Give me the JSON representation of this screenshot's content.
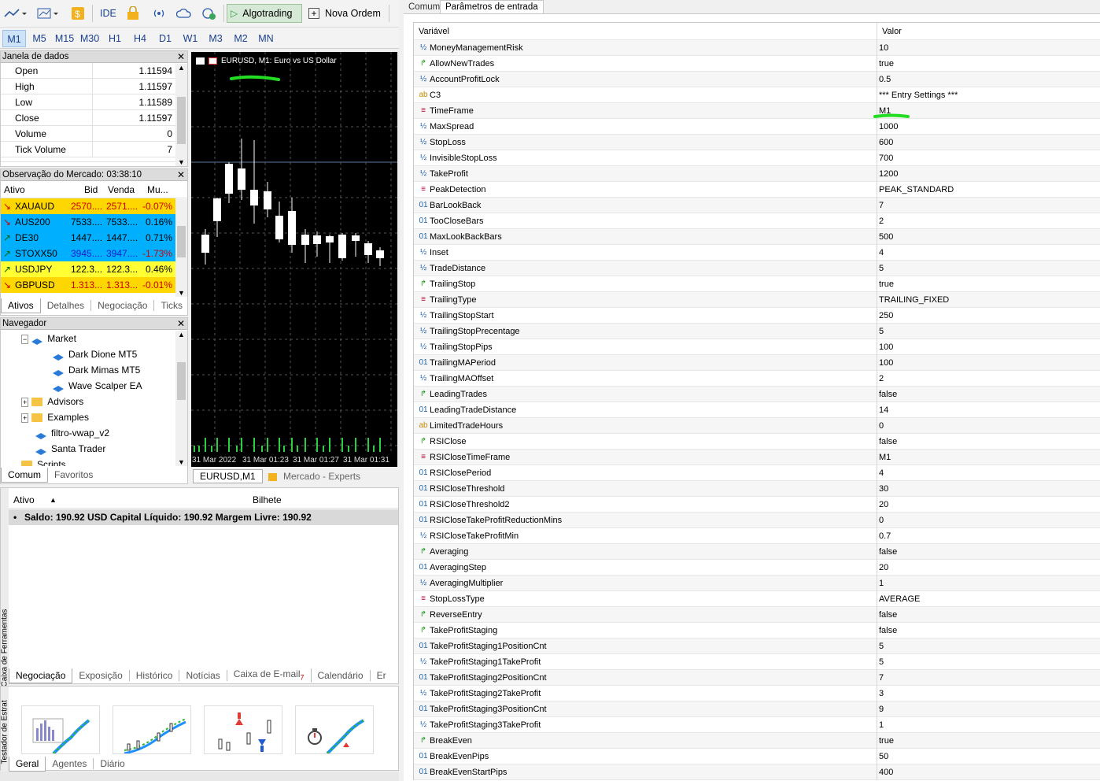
{
  "toolbar": {
    "ide": "IDE",
    "algotrading": "Algotrading",
    "nova_ordem": "Nova Ordem"
  },
  "timeframes": [
    "M1",
    "M5",
    "M15",
    "M30",
    "H1",
    "H4",
    "D1",
    "W1",
    "M3",
    "M2",
    "MN"
  ],
  "data_window": {
    "title": "Janela de dados",
    "rows": [
      {
        "k": "Open",
        "v": "1.11594"
      },
      {
        "k": "High",
        "v": "1.11597"
      },
      {
        "k": "Low",
        "v": "1.11589"
      },
      {
        "k": "Close",
        "v": "1.11597"
      },
      {
        "k": "Volume",
        "v": "0"
      },
      {
        "k": "Tick Volume",
        "v": "7"
      }
    ]
  },
  "market_watch": {
    "title": "Observação do Mercado: 03:38:10",
    "headers": [
      "Ativo",
      "Bid",
      "Venda",
      "Mu..."
    ],
    "rows": [
      {
        "sym": "XAUAUD",
        "bid": "2570....",
        "ask": "2571....",
        "chg": "-0.07%",
        "bg": "#ffd700",
        "arrow": "↘",
        "arrowc": "#cc0000",
        "chgc": "#cc0000",
        "bidc": "#cc0000"
      },
      {
        "sym": "AUS200",
        "bid": "7533....",
        "ask": "7533....",
        "chg": "0.16%",
        "bg": "#00b0ff",
        "arrow": "↘",
        "arrowc": "#cc0000",
        "chgc": "#000",
        "bidc": "#000"
      },
      {
        "sym": "DE30",
        "bid": "1447....",
        "ask": "1447....",
        "chg": "0.71%",
        "bg": "#00b0ff",
        "arrow": "↗",
        "arrowc": "#006600",
        "chgc": "#000",
        "bidc": "#000"
      },
      {
        "sym": "STOXX50",
        "bid": "3945....",
        "ask": "3947....",
        "chg": "-1.73%",
        "bg": "#00b0ff",
        "arrow": "↗",
        "arrowc": "#006600",
        "chgc": "#cc0000",
        "bidc": "#1a1ad0"
      },
      {
        "sym": "USDJPY",
        "bid": "122.3...",
        "ask": "122.3...",
        "chg": "0.46%",
        "bg": "#ffff33",
        "arrow": "↗",
        "arrowc": "#006600",
        "chgc": "#000",
        "bidc": "#000"
      },
      {
        "sym": "GBPUSD",
        "bid": "1.313...",
        "ask": "1.313...",
        "chg": "-0.01%",
        "bg": "#ffd700",
        "arrow": "↘",
        "arrowc": "#cc0000",
        "chgc": "#cc0000",
        "bidc": "#cc0000"
      }
    ],
    "tabs": [
      "Ativos",
      "Detalhes",
      "Negociação",
      "Ticks"
    ]
  },
  "navigator": {
    "title": "Navegador",
    "items": [
      "Market",
      "Dark Dione MT5",
      "Dark Mimas MT5",
      "Wave Scalper EA",
      "Advisors",
      "Examples",
      "filtro-vwap_v2",
      "Santa Trader",
      "Scripts"
    ],
    "tabs": [
      "Comum",
      "Favoritos"
    ]
  },
  "chart": {
    "title": "EURUSD, M1:  Euro vs US Dollar",
    "dates": [
      "31 Mar 2022",
      "31 Mar 01:23",
      "31 Mar 01:27",
      "31 Mar 01:31"
    ],
    "tabs": [
      "EURUSD,M1",
      "Mercado - Experts"
    ]
  },
  "toolbox": {
    "headers": [
      "Ativo",
      "Bilhete"
    ],
    "balance": "Saldo: 190.92 USD  Capital Líquido: 190.92  Margem Livre: 190.92",
    "side_label": "Caixa de Ferramentas",
    "tabs": [
      "Negociação",
      "Exposição",
      "Histórico",
      "Notícias",
      "Caixa de E-mail",
      "Calendário",
      "Er"
    ],
    "mail_badge": "7"
  },
  "tester": {
    "side_label": "Testador de Estrat",
    "tabs": [
      "Geral",
      "Agentes",
      "Diário"
    ]
  },
  "params": {
    "tabs": [
      "Comum",
      "Parâmetros de entrada"
    ],
    "headers": [
      "Variável",
      "Valor"
    ],
    "rows": [
      {
        "ic": "½",
        "n": "MoneyManagementRisk",
        "v": "10"
      },
      {
        "ic": "↱",
        "n": "AllowNewTrades",
        "v": "true"
      },
      {
        "ic": "½",
        "n": "AccountProfitLock",
        "v": "0.5"
      },
      {
        "ic": "ab",
        "n": "C3",
        "v": "*** Entry Settings ***"
      },
      {
        "ic": "≡",
        "n": "TimeFrame",
        "v": "M1"
      },
      {
        "ic": "½",
        "n": "MaxSpread",
        "v": "1000"
      },
      {
        "ic": "½",
        "n": "StopLoss",
        "v": "600"
      },
      {
        "ic": "½",
        "n": "InvisibleStopLoss",
        "v": "700"
      },
      {
        "ic": "½",
        "n": "TakeProfit",
        "v": "1200"
      },
      {
        "ic": "≡",
        "n": "PeakDetection",
        "v": "PEAK_STANDARD"
      },
      {
        "ic": "01",
        "n": "BarLookBack",
        "v": "7"
      },
      {
        "ic": "01",
        "n": "TooCloseBars",
        "v": "2"
      },
      {
        "ic": "01",
        "n": "MaxLookBackBars",
        "v": "500"
      },
      {
        "ic": "½",
        "n": "Inset",
        "v": "4"
      },
      {
        "ic": "½",
        "n": "TradeDistance",
        "v": "5"
      },
      {
        "ic": "↱",
        "n": "TrailingStop",
        "v": "true"
      },
      {
        "ic": "≡",
        "n": "TrailingType",
        "v": "TRAILING_FIXED"
      },
      {
        "ic": "½",
        "n": "TrailingStopStart",
        "v": "250"
      },
      {
        "ic": "½",
        "n": "TrailingStopPrecentage",
        "v": "5"
      },
      {
        "ic": "½",
        "n": "TrailingStopPips",
        "v": "100"
      },
      {
        "ic": "01",
        "n": "TrailingMAPeriod",
        "v": "100"
      },
      {
        "ic": "½",
        "n": "TrailingMAOffset",
        "v": "2"
      },
      {
        "ic": "↱",
        "n": "LeadingTrades",
        "v": "false"
      },
      {
        "ic": "01",
        "n": "LeadingTradeDistance",
        "v": "14"
      },
      {
        "ic": "ab",
        "n": "LimitedTradeHours",
        "v": "0"
      },
      {
        "ic": "↱",
        "n": "RSIClose",
        "v": "false"
      },
      {
        "ic": "≡",
        "n": "RSICloseTimeFrame",
        "v": "M1"
      },
      {
        "ic": "01",
        "n": "RSIClosePeriod",
        "v": "4"
      },
      {
        "ic": "01",
        "n": "RSICloseThreshold",
        "v": "30"
      },
      {
        "ic": "01",
        "n": "RSICloseThreshold2",
        "v": "20"
      },
      {
        "ic": "01",
        "n": "RSICloseTakeProfitReductionMins",
        "v": "0"
      },
      {
        "ic": "½",
        "n": "RSICloseTakeProfitMin",
        "v": "0.7"
      },
      {
        "ic": "↱",
        "n": "Averaging",
        "v": "false"
      },
      {
        "ic": "01",
        "n": "AveragingStep",
        "v": "20"
      },
      {
        "ic": "½",
        "n": "AveragingMultiplier",
        "v": "1"
      },
      {
        "ic": "≡",
        "n": "StopLossType",
        "v": "AVERAGE"
      },
      {
        "ic": "↱",
        "n": "ReverseEntry",
        "v": "false"
      },
      {
        "ic": "↱",
        "n": "TakeProfitStaging",
        "v": "false"
      },
      {
        "ic": "01",
        "n": "TakeProfitStaging1PositionCnt",
        "v": "5"
      },
      {
        "ic": "½",
        "n": "TakeProfitStaging1TakeProfit",
        "v": "5"
      },
      {
        "ic": "01",
        "n": "TakeProfitStaging2PositionCnt",
        "v": "7"
      },
      {
        "ic": "½",
        "n": "TakeProfitStaging2TakeProfit",
        "v": "3"
      },
      {
        "ic": "01",
        "n": "TakeProfitStaging3PositionCnt",
        "v": "9"
      },
      {
        "ic": "½",
        "n": "TakeProfitStaging3TakeProfit",
        "v": "1"
      },
      {
        "ic": "↱",
        "n": "BreakEven",
        "v": "true"
      },
      {
        "ic": "01",
        "n": "BreakEvenPips",
        "v": "50"
      },
      {
        "ic": "01",
        "n": "BreakEvenStartPips",
        "v": "400"
      }
    ]
  }
}
